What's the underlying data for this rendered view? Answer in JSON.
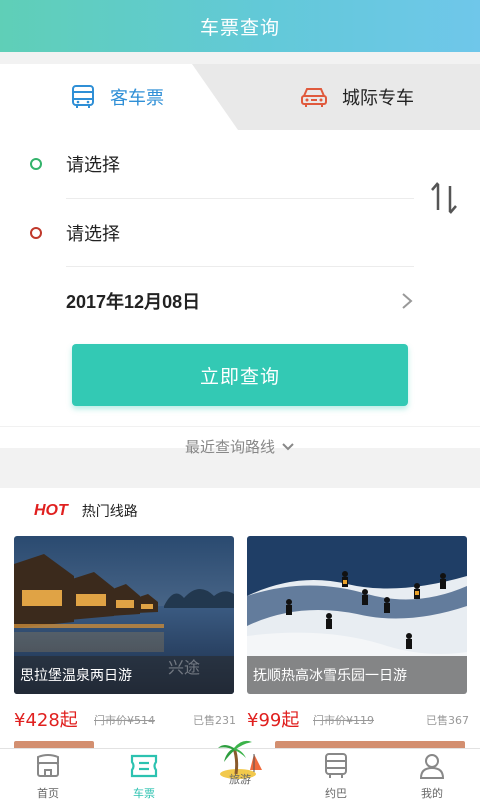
{
  "header": {
    "title": "车票查询"
  },
  "tabs": {
    "bus": "客车票",
    "intercity": "城际专车"
  },
  "form": {
    "from": "请选择",
    "to": "请选择",
    "date": "2017年12月08日",
    "search_button": "立即查询",
    "recent_routes": "最近查询路线"
  },
  "hot": {
    "badge": "HOT",
    "title": "热门线路",
    "cards": [
      {
        "caption": "思拉堡温泉两日游",
        "watermark": "兴途",
        "price": "¥428起",
        "market_price": "门市价¥514",
        "sold": "已售231"
      },
      {
        "caption": "抚顺热高冰雪乐园一日游",
        "price": "¥99起",
        "market_price": "门市价¥119",
        "sold": "已售367"
      }
    ]
  },
  "tabbar": {
    "items": [
      {
        "label": "首页",
        "icon": "home-icon"
      },
      {
        "label": "车票",
        "icon": "ticket-icon"
      },
      {
        "label": "旅游",
        "icon": "palm-island-icon"
      },
      {
        "label": "约巴",
        "icon": "bus-icon"
      },
      {
        "label": "我的",
        "icon": "user-icon"
      }
    ],
    "active_color": "#2cc2b0"
  },
  "colors": {
    "accent": "#33c9b4",
    "price": "#e0201f",
    "bus_tab": "#2f8fd6"
  }
}
